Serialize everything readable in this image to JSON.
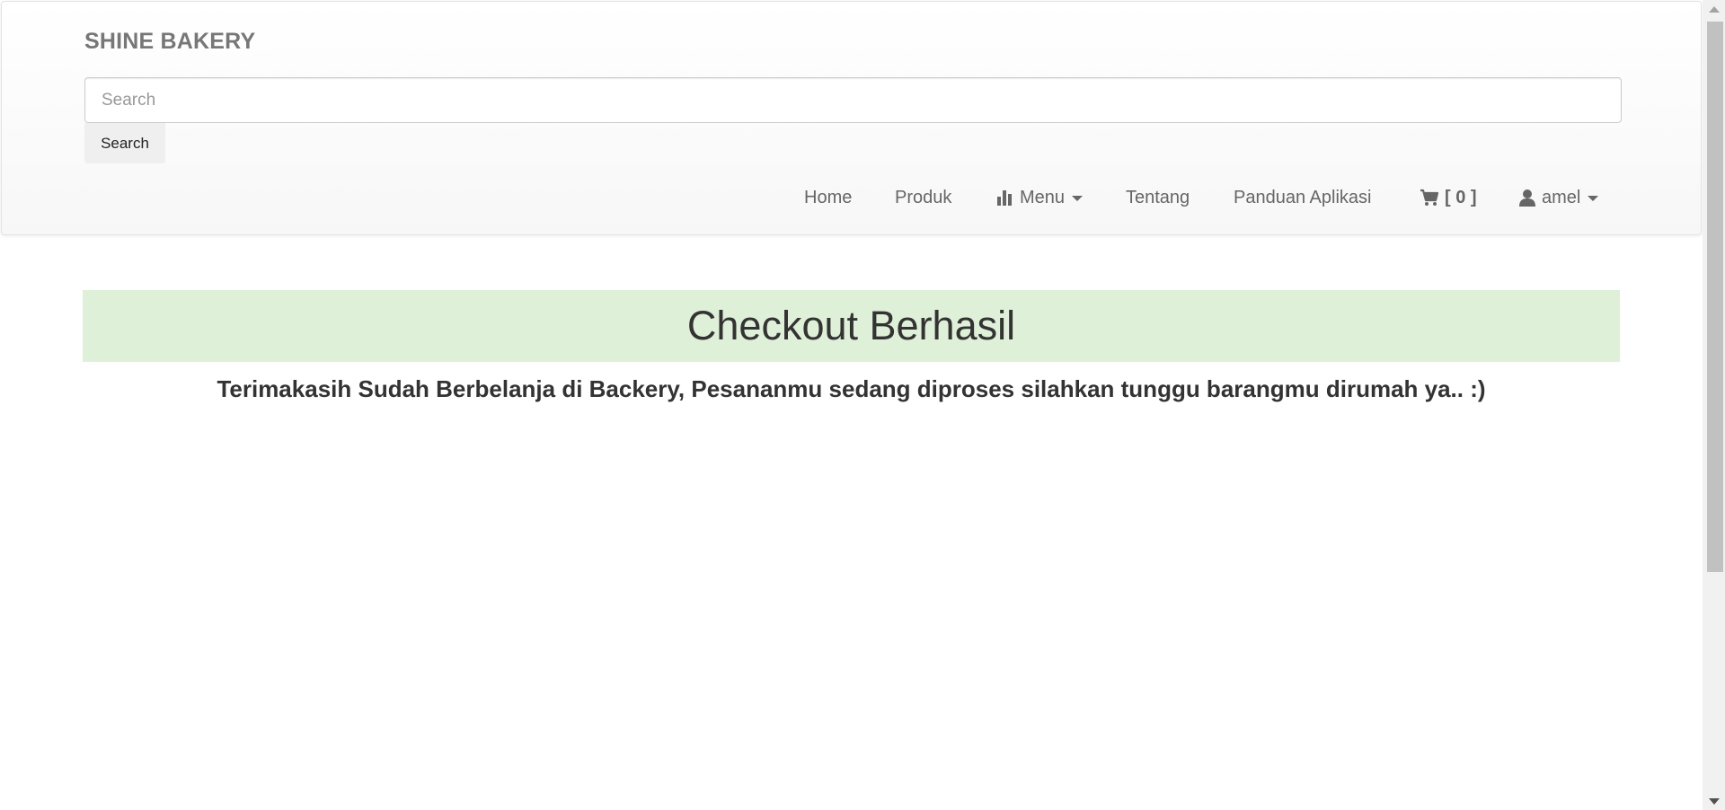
{
  "header": {
    "brand": "SHINE BAKERY",
    "search": {
      "placeholder": "Search",
      "value": "",
      "button_label": "Search"
    },
    "nav": {
      "home": "Home",
      "produk": "Produk",
      "menu": {
        "label": "Menu",
        "icon": "bar-chart-icon"
      },
      "tentang": "Tentang",
      "panduan": "Panduan Aplikasi",
      "cart": {
        "icon": "shopping-cart-icon",
        "count_text": "[ 0 ]"
      },
      "user": {
        "icon": "user-icon",
        "name": "amel"
      }
    }
  },
  "main": {
    "title": "Checkout Berhasil",
    "message": "Terimakasih Sudah Berbelanja di Backery, Pesananmu sedang diproses silahkan tunggu barangmu dirumah ya.. :)"
  },
  "colors": {
    "success_background": "#dff0d8",
    "brand_text": "#777777",
    "nav_text": "#666666"
  }
}
